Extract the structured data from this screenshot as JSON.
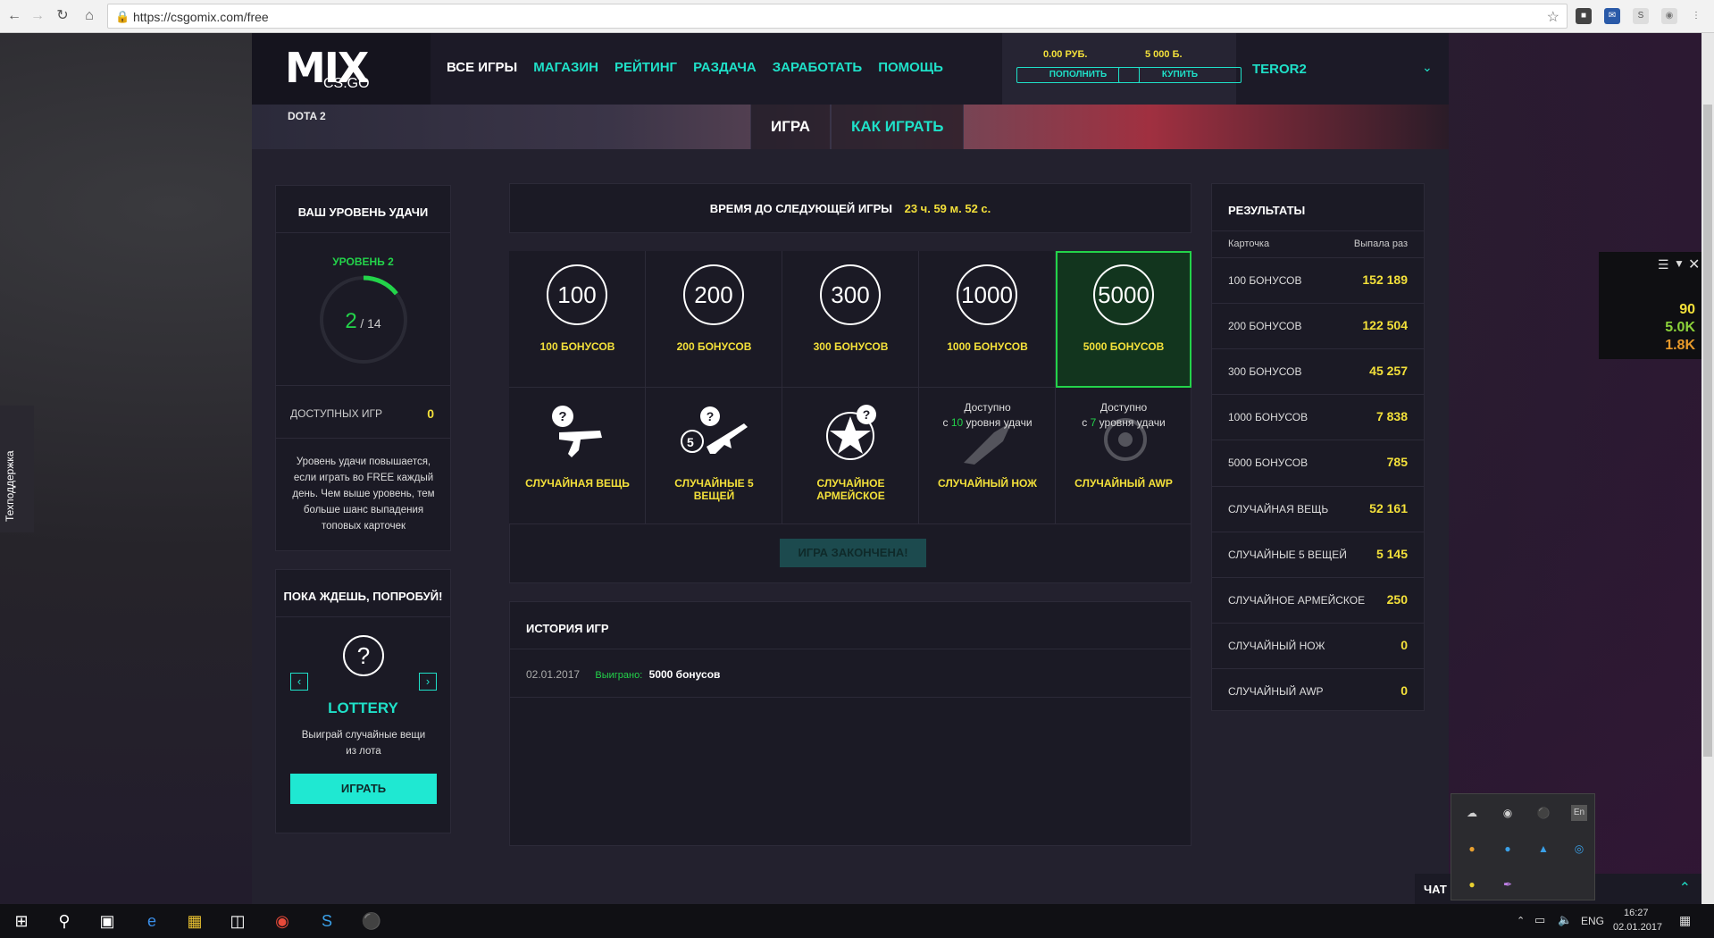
{
  "browser": {
    "url": "https://csgomix.com/free"
  },
  "header": {
    "logo_mix": "MIX",
    "logo_sub": "CS:GO",
    "nav": [
      "ВСЕ ИГРЫ",
      "МАГАЗИН",
      "РЕЙТИНГ",
      "РАЗДАЧА",
      "ЗАРАБОТАТЬ",
      "ПОМОЩЬ"
    ],
    "balance_rub": "0.00 РУБ.",
    "balance_b": "5 000 Б.",
    "topup_label": "ПОПОЛНИТЬ",
    "buy_label": "КУПИТЬ",
    "username": "TEROR2",
    "dota": "DOTA 2"
  },
  "tabs": [
    "ИГРА",
    "КАК ИГРАТЬ"
  ],
  "luck": {
    "title": "ВАШ УРОВЕНЬ УДАЧИ",
    "level": "УРОВЕНЬ 2",
    "current": "2",
    "total": "/ 14",
    "progress": 0.143,
    "available_label": "ДОСТУПНЫХ ИГР",
    "available_value": "0",
    "desc": "Уровень удачи повышается, если играть во FREE каждый день. Чем выше уровень, тем больше шанс выпадения топовых карточек"
  },
  "try": {
    "title": "ПОКА ЖДЕШЬ, ПОПРОБУЙ!",
    "name": "LOTTERY",
    "desc": "Выиграй случайные вещи из лота",
    "play_label": "ИГРАТЬ"
  },
  "timer": {
    "label": "ВРЕМЯ ДО СЛЕДУЮЩЕЙ ИГРЫ",
    "value": "23 ч. 59 м. 52 с."
  },
  "cards_top": [
    {
      "num": "100",
      "label": "100 БОНУСОВ"
    },
    {
      "num": "200",
      "label": "200 БОНУСОВ"
    },
    {
      "num": "300",
      "label": "300 БОНУСОВ"
    },
    {
      "num": "1000",
      "label": "1000 БОНУСОВ"
    },
    {
      "num": "5000",
      "label": "5000 БОНУСОВ"
    }
  ],
  "cards_bottom": [
    {
      "label": "СЛУЧАЙНАЯ ВЕЩЬ"
    },
    {
      "label": "СЛУЧАЙНЫЕ 5 ВЕЩЕЙ",
      "badge": "5"
    },
    {
      "label": "СЛУЧАЙНОЕ АРМЕЙСКОЕ"
    },
    {
      "label": "СЛУЧАЙНЫЙ НОЖ",
      "avail_a": "Доступно",
      "avail_b": "с",
      "avail_lvl": "10",
      "avail_c": "уровня удачи"
    },
    {
      "label": "СЛУЧАЙНЫЙ AWP",
      "avail_a": "Доступно",
      "avail_b": "с",
      "avail_lvl": "7",
      "avail_c": "уровня удачи"
    }
  ],
  "game_over": "ИГРА ЗАКОНЧЕНА!",
  "history": {
    "title": "ИСТОРИЯ ИГР",
    "date": "02.01.2017",
    "won_label": "Выиграно:",
    "won_value": "5000 бонусов"
  },
  "results": {
    "title": "РЕЗУЛЬТАТЫ",
    "col_card": "Карточка",
    "col_count": "Выпала раз",
    "rows": [
      {
        "name": "100 БОНУСОВ",
        "value": "152 189"
      },
      {
        "name": "200 БОНУСОВ",
        "value": "122 504"
      },
      {
        "name": "300 БОНУСОВ",
        "value": "45 257"
      },
      {
        "name": "1000 БОНУСОВ",
        "value": "7 838"
      },
      {
        "name": "5000 БОНУСОВ",
        "value": "785"
      },
      {
        "name": "СЛУЧАЙНАЯ ВЕЩЬ",
        "value": "52 161"
      },
      {
        "name": "СЛУЧАЙНЫЕ 5 ВЕЩЕЙ",
        "value": "5 145"
      },
      {
        "name": "СЛУЧАЙНОЕ АРМЕЙСКОЕ",
        "value": "250"
      },
      {
        "name": "СЛУЧАЙНЫЙ НОЖ",
        "value": "0"
      },
      {
        "name": "СЛУЧАЙНЫЙ AWP",
        "value": "0"
      }
    ]
  },
  "support": "Техподдержка",
  "chat": "ЧАТ",
  "overlay": {
    "v1": "90",
    "v2": "5.0K",
    "v3": "1.8K"
  },
  "taskbar": {
    "lang": "ENG",
    "time": "16:27",
    "date": "02.01.2017"
  },
  "tray": {
    "en": "En"
  }
}
